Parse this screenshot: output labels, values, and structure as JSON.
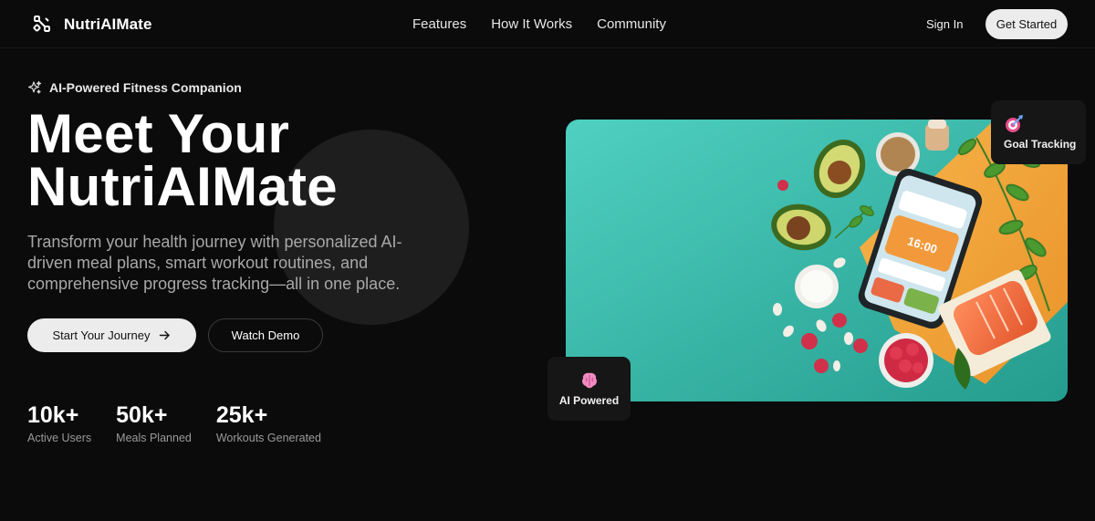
{
  "brand": {
    "name": "NutriAIMate",
    "logo_icon": "molecule-icon"
  },
  "nav": {
    "links": [
      {
        "label": "Features"
      },
      {
        "label": "How It Works"
      },
      {
        "label": "Community"
      }
    ],
    "signin_label": "Sign In",
    "cta_label": "Get Started"
  },
  "hero": {
    "badge_icon": "sparkles-icon",
    "badge_text": "AI-Powered Fitness Companion",
    "headline_line1": "Meet Your",
    "headline_line2": "NutriAIMate",
    "subtitle": "Transform your health journey with personalized AI-driven meal plans, smart workout routines, and comprehensive progress tracking—all in one place.",
    "primary_button": "Start Your Journey",
    "primary_button_icon": "arrow-right-icon",
    "secondary_button": "Watch Demo",
    "stats": [
      {
        "value": "10k+",
        "label": "Active Users"
      },
      {
        "value": "50k+",
        "label": "Meals Planned"
      },
      {
        "value": "25k+",
        "label": "Workouts Generated"
      }
    ]
  },
  "image": {
    "description": "food-flatlay-with-phone-app",
    "phone_time": "16:00"
  },
  "cards": {
    "goal": {
      "icon": "target-icon",
      "label": "Goal Tracking"
    },
    "ai": {
      "icon": "brain-icon",
      "label": "AI Powered"
    }
  },
  "colors": {
    "background": "#0b0b0b",
    "teal": "#3ec4b4",
    "orange": "#f3a93c",
    "button_light": "#ececec"
  }
}
